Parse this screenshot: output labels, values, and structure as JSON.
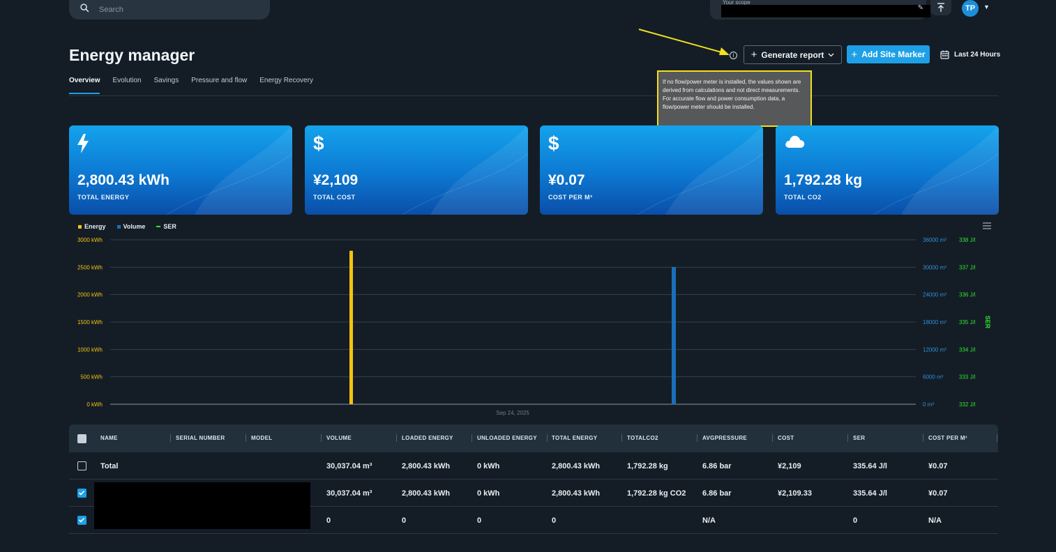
{
  "topbar": {
    "search_placeholder": "Search",
    "scope_label": "Your scope",
    "avatar_initials": "TP"
  },
  "header": {
    "title": "Energy manager",
    "generate_report": "Generate report",
    "add_site_marker": "Add Site Marker",
    "time_range": "Last 24 Hours"
  },
  "tabs": [
    "Overview",
    "Evolution",
    "Savings",
    "Pressure and flow",
    "Energy Recovery"
  ],
  "tooltip": "If no flow/power meter is installed, the values shown are derived from calculations and not direct measurements. For accurate flow and power consumption data, a flow/power meter should be installed.",
  "cards": [
    {
      "value": "2,800.43 kWh",
      "caption": "TOTAL ENERGY",
      "icon": "bolt-icon"
    },
    {
      "value": "¥2,109",
      "caption": "TOTAL COST",
      "icon": "dollar-icon"
    },
    {
      "value": "¥0.07",
      "caption": "COST PER M³",
      "icon": "dollar-icon"
    },
    {
      "value": "1,792.28 kg",
      "caption": "TOTAL CO2",
      "icon": "cloud-icon"
    }
  ],
  "colors": {
    "energy": "#f5c211",
    "volume": "#1a6fb8",
    "ser": "#2ee52e",
    "accent": "#1ea0e6"
  },
  "chart_data": {
    "type": "bar",
    "x_label_text": "Sep 24, 2025",
    "series": [
      {
        "name": "Energy",
        "axis": "left",
        "values": [
          2800.43
        ]
      },
      {
        "name": "Volume",
        "axis": "right",
        "values": [
          30037.04
        ]
      },
      {
        "name": "SER",
        "axis": "ser",
        "values": []
      }
    ],
    "left_axis": {
      "ticks": [
        "3000 kWh",
        "2500 kWh",
        "2000 kWh",
        "1500 kWh",
        "1000 kWh",
        "500 kWh",
        "0 kWh"
      ],
      "ylim": [
        0,
        3000
      ]
    },
    "right_axis": {
      "ticks": [
        "36000 m³",
        "30000 m³",
        "24000 m³",
        "18000 m³",
        "12000 m³",
        "6000 m³",
        "0 m³"
      ],
      "ylim": [
        0,
        36000
      ]
    },
    "ser_axis": {
      "title": "SER",
      "ticks": [
        "338 J/l",
        "337 J/l",
        "336 J/l",
        "335 J/l",
        "334 J/l",
        "333 J/l",
        "332 J/l"
      ],
      "ylim": [
        332,
        338
      ]
    },
    "grid": true,
    "legend": "top-left"
  },
  "table": {
    "columns": [
      "NAME",
      "SERIAL NUMBER",
      "MODEL",
      "VOLUME",
      "LOADED ENERGY",
      "UNLOADED ENERGY",
      "TOTAL ENERGY",
      "TOTALCO2",
      "AVGPRESSURE",
      "COST",
      "SER",
      "COST PER M³"
    ],
    "rows": [
      {
        "name": "Total",
        "volume": "30,037.04 m³",
        "loaded": "2,800.43 kWh",
        "unloaded": "0 kWh",
        "total": "2,800.43 kWh",
        "co2": "1,792.28 kg",
        "pressure": "6.86 bar",
        "cost": "¥2,109",
        "ser": "335.64 J/l",
        "cpm": "¥0.07"
      },
      {
        "name": "",
        "volume": "30,037.04 m³",
        "loaded": "2,800.43 kWh",
        "unloaded": "0 kWh",
        "total": "2,800.43 kWh",
        "co2": "1,792.28 kg CO2",
        "pressure": "6.86 bar",
        "cost": "¥2,109.33",
        "ser": "335.64 J/l",
        "cpm": "¥0.07"
      },
      {
        "name": "",
        "volume": "0",
        "loaded": "0",
        "unloaded": "0",
        "total": "0",
        "co2": "",
        "pressure": "N/A",
        "cost": "",
        "ser": "0",
        "cpm": "N/A"
      }
    ]
  }
}
